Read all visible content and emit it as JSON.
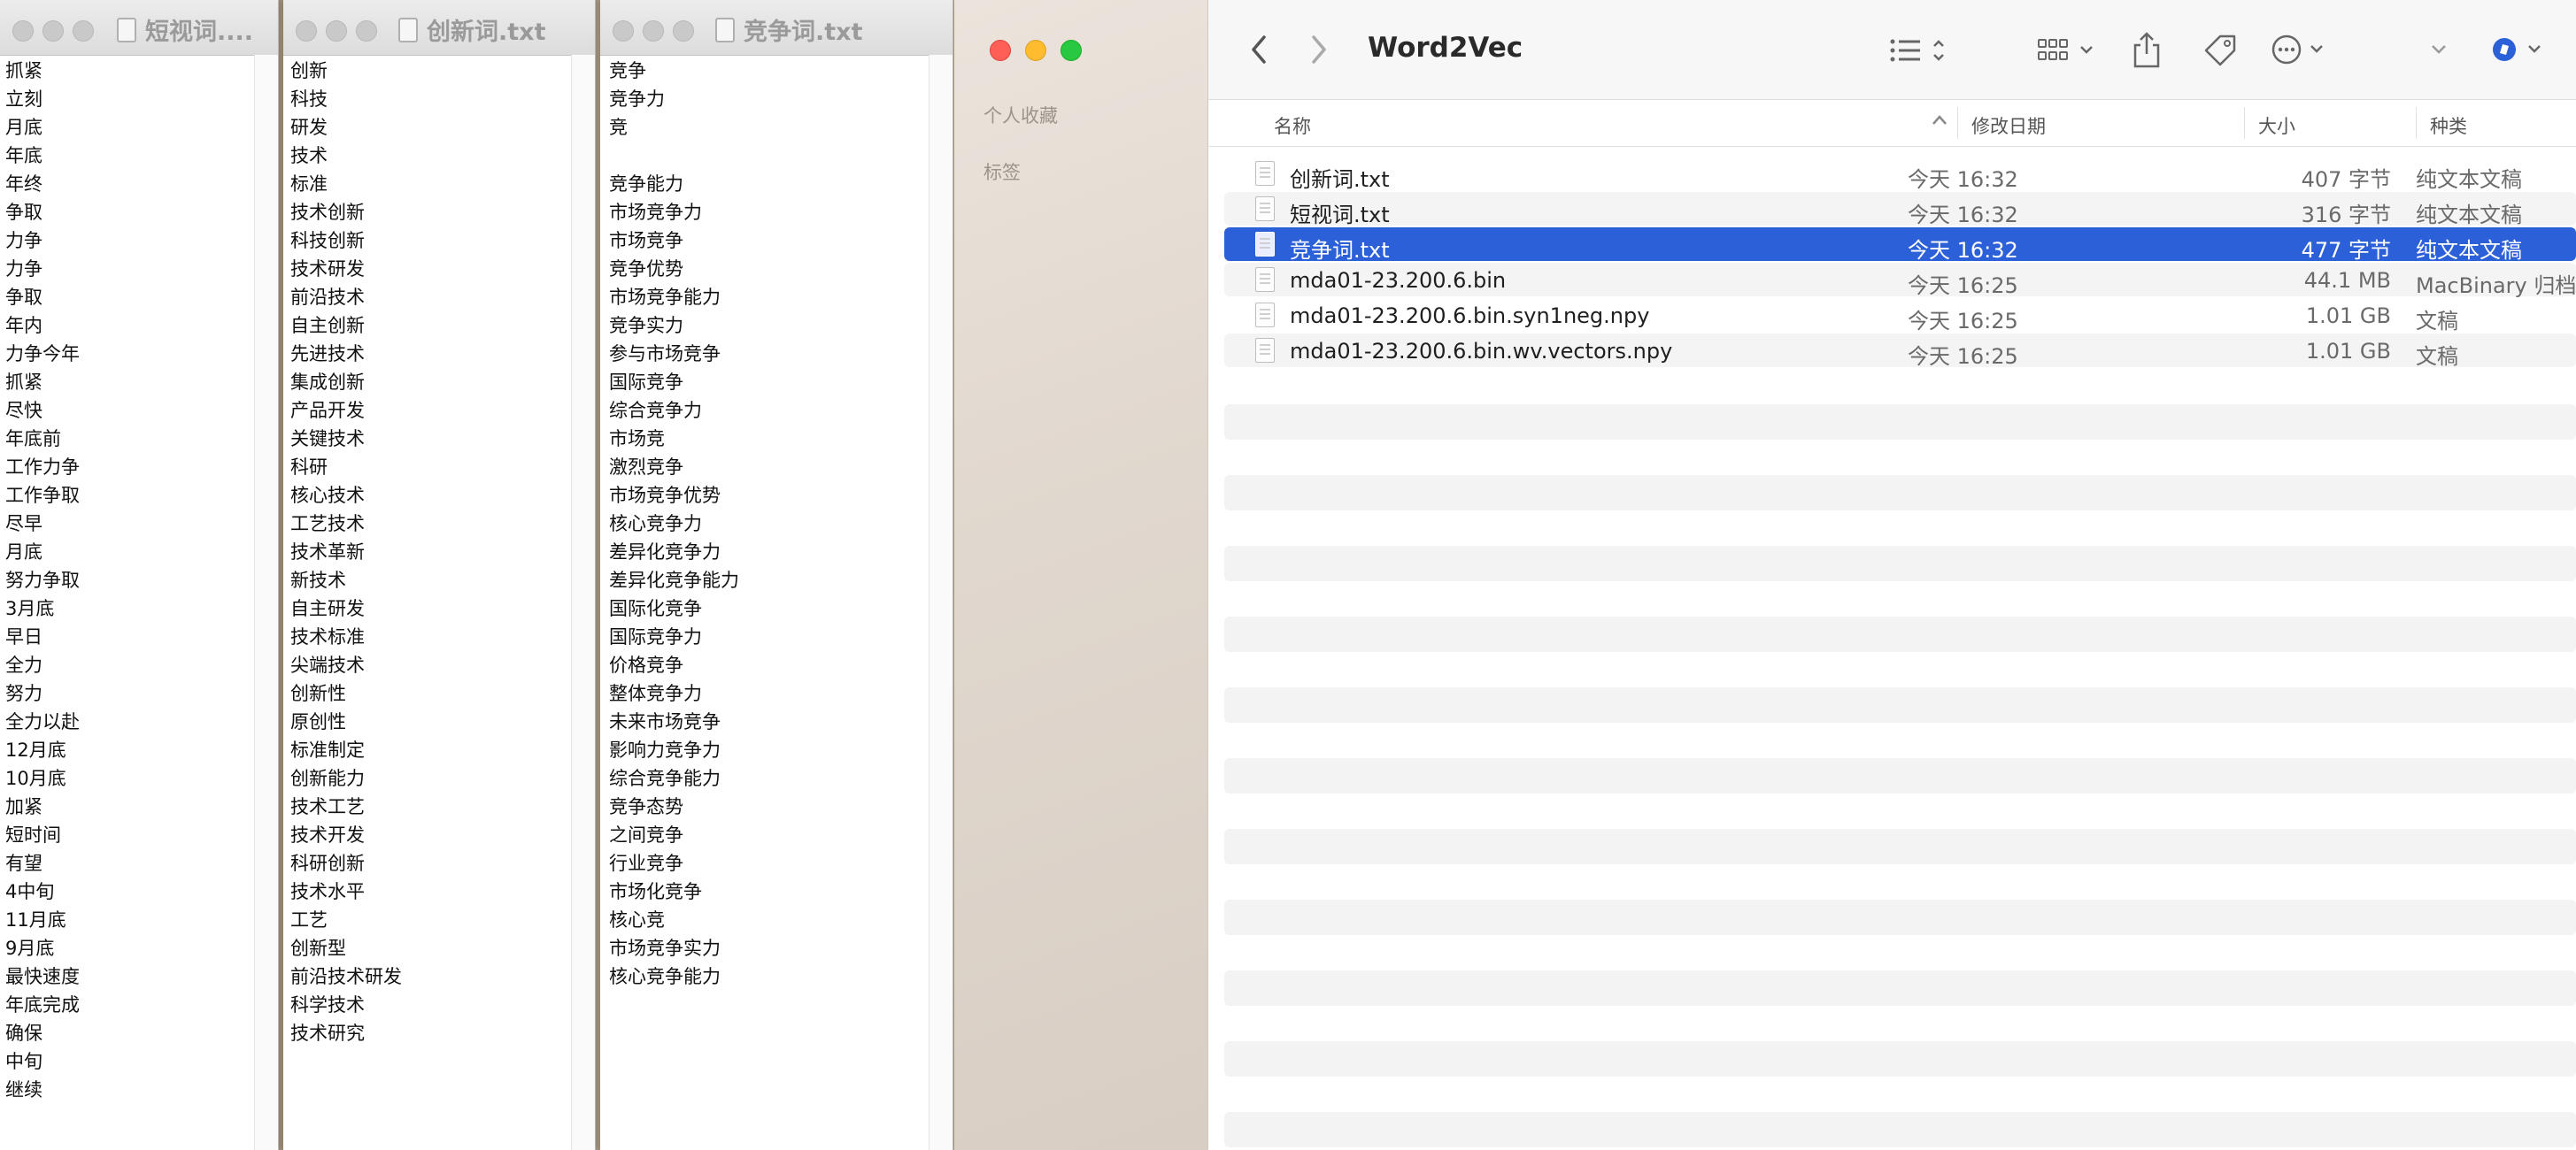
{
  "window1": {
    "title": "短视词....",
    "lines": [
      "抓紧",
      "立刻",
      "月底",
      "年底",
      "年终",
      "争取",
      "力争",
      "力争",
      "争取",
      "年内",
      "力争今年",
      "抓紧",
      "尽快",
      "年底前",
      "工作力争",
      "工作争取",
      "尽早",
      "月底",
      "努力争取",
      "3月底",
      "早日",
      "全力",
      "努力",
      "全力以赴",
      "12月底",
      "10月底",
      "加紧",
      "短时间",
      "有望",
      "4中旬",
      "11月底",
      "9月底",
      "最快速度",
      "年底完成",
      "确保",
      "中旬",
      "继续"
    ]
  },
  "window2": {
    "title": "创新词.txt",
    "lines": [
      "创新",
      "科技",
      "研发",
      "技术",
      "标准",
      "技术创新",
      "科技创新",
      "技术研发",
      "前沿技术",
      "自主创新",
      "先进技术",
      "集成创新",
      "产品开发",
      "关键技术",
      "科研",
      "核心技术",
      "工艺技术",
      "技术革新",
      "新技术",
      "自主研发",
      "技术标准",
      "尖端技术",
      "创新性",
      "原创性",
      "标准制定",
      "创新能力",
      "技术工艺",
      "技术开发",
      "科研创新",
      "技术水平",
      "工艺",
      "创新型",
      "前沿技术研发",
      "科学技术",
      "技术研究"
    ]
  },
  "window3": {
    "title": "竞争词.txt",
    "lines": [
      "竞争",
      "竞争力",
      "竞",
      "",
      "竞争能力",
      "市场竞争力",
      "市场竞争",
      "竞争优势",
      "市场竞争能力",
      "竞争实力",
      "参与市场竞争",
      "国际竞争",
      "综合竞争力",
      "市场竞",
      "激烈竞争",
      "市场竞争优势",
      "核心竞争力",
      "差异化竞争力",
      "差异化竞争能力",
      "国际化竞争",
      "国际竞争力",
      "价格竞争",
      "整体竞争力",
      "未来市场竞争",
      "影响力竞争力",
      "综合竞争能力",
      "竞争态势",
      "之间竞争",
      "行业竞争",
      "市场化竞争",
      "核心竞",
      "市场竞争实力",
      "核心竞争能力"
    ]
  },
  "finder": {
    "title": "Word2Vec",
    "sidebar": {
      "favorites": "个人收藏",
      "tags": "标签"
    },
    "columns": {
      "name": "名称",
      "date": "修改日期",
      "size": "大小",
      "kind": "种类"
    },
    "files": [
      {
        "name": "创新词.txt",
        "date": "今天 16:32",
        "size": "407 字节",
        "kind": "纯文本文稿"
      },
      {
        "name": "短视词.txt",
        "date": "今天 16:32",
        "size": "316 字节",
        "kind": "纯文本文稿"
      },
      {
        "name": "竞争词.txt",
        "date": "今天 16:32",
        "size": "477 字节",
        "kind": "纯文本文稿",
        "selected": true
      },
      {
        "name": "mda01-23.200.6.bin",
        "date": "今天 16:25",
        "size": "44.1 MB",
        "kind": "MacBinary 归档"
      },
      {
        "name": "mda01-23.200.6.bin.syn1neg.npy",
        "date": "今天 16:25",
        "size": "1.01 GB",
        "kind": "文稿"
      },
      {
        "name": "mda01-23.200.6.bin.wv.vectors.npy",
        "date": "今天 16:25",
        "size": "1.01 GB",
        "kind": "文稿"
      }
    ]
  }
}
